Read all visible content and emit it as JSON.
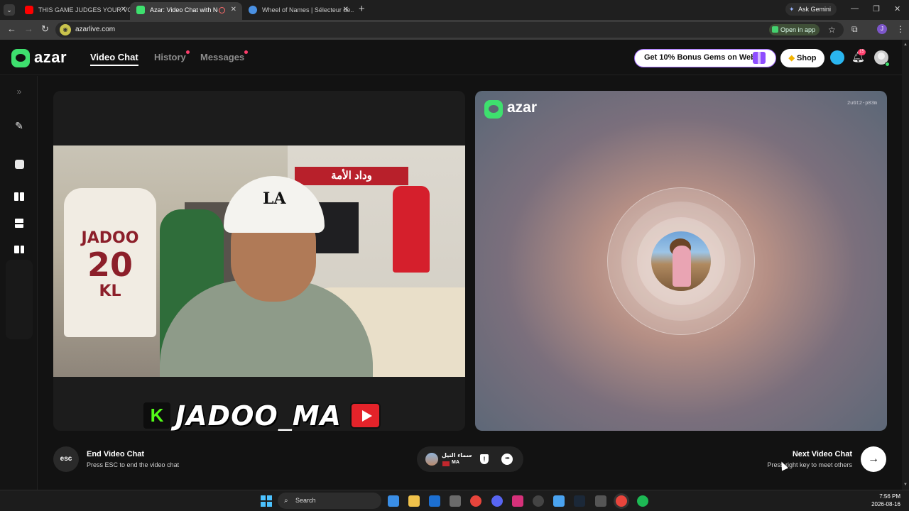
{
  "browser": {
    "tabs": [
      {
        "title": "THIS GAME JUDGES YOUR VO...",
        "favicon_color": "#ff0000"
      },
      {
        "title": "Azar: Video Chat with New...",
        "favicon_color": "#3ee06e"
      },
      {
        "title": "Wheel of Names | Sélecteur de...",
        "favicon_color": "#4a90e2"
      }
    ],
    "new_tab": "+",
    "ask_gemini": "Ask Gemini",
    "url": "azarlive.com",
    "open_in_app": "Open in app"
  },
  "app": {
    "brand": "azar",
    "nav": [
      {
        "label": "Video Chat",
        "active": true
      },
      {
        "label": "History",
        "dot": true
      },
      {
        "label": "Messages",
        "dot": true
      }
    ],
    "promo_button": "Get 10% Bonus Gems on Web!",
    "shop_button": "Shop",
    "notification_count": "15"
  },
  "rail": {
    "expand_icon": "double-chevron-right-icon",
    "items": [
      "magic-wand-icon",
      "filter-icon",
      "layout-side-by-side-icon",
      "layout-stacked-icon",
      "layout-grid-icon"
    ]
  },
  "local_video": {
    "jersey_name": "JADOO",
    "jersey_number": "20",
    "jersey_initials": "KL",
    "banner_text": "وداد الأمة",
    "cap_logo": "LA",
    "handle": "JADOO_MA"
  },
  "remote_video": {
    "brand": "azar",
    "session_id": "2uGt2-p03m",
    "status": "connecting"
  },
  "controls": {
    "esc_label": "esc",
    "end_title": "End Video Chat",
    "end_subtitle": "Press ESC to end the video chat",
    "partner_name": "سماء النيل",
    "partner_country": "MA",
    "next_title": "Next Video Chat",
    "next_subtitle": "Press right key to meet others"
  },
  "taskbar": {
    "search_placeholder": "Search",
    "time": "7:56 PM",
    "date": "2026-08-16"
  },
  "colors": {
    "accent_green": "#3ee06e",
    "notification_red": "#ff3d6b",
    "promo_purple": "#a36bff"
  }
}
